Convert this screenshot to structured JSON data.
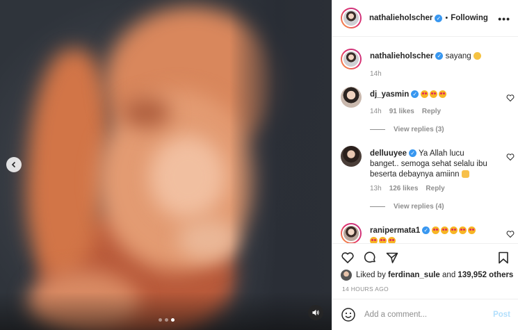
{
  "header": {
    "username": "nathalieholscher",
    "separator": "•",
    "follow_state": "Following",
    "more_label": "•••"
  },
  "caption": {
    "username": "nathalieholscher",
    "text": "sayang",
    "time": "14h"
  },
  "comments": [
    {
      "username": "dj_yasmin",
      "text": "",
      "emoji": [
        "smiling-face-with-heart-eyes",
        "smiling-face-with-heart-eyes",
        "smiling-face-with-heart-eyes"
      ],
      "time": "14h",
      "likes": "91 likes",
      "reply": "Reply",
      "view_replies": "View replies (3)"
    },
    {
      "username": "delluuyee",
      "text": "Ya Allah lucu banget.. semoga sehat selalu ibu beserta debaynya amiinn",
      "time": "13h",
      "likes": "126 likes",
      "reply": "Reply",
      "view_replies": "View replies (4)"
    },
    {
      "username": "ranipermata1",
      "text": ""
    }
  ],
  "liked_by": {
    "prefix": "Liked by",
    "user": "ferdinan_sule",
    "and": "and",
    "others": "139,952 others"
  },
  "timestamp": "14 HOURS AGO",
  "composer": {
    "placeholder": "Add a comment...",
    "post_label": "Post"
  },
  "carousel": {
    "total": 3,
    "active": 3
  },
  "colors": {
    "verified": "#3897f0",
    "post_disabled": "#b2dffc",
    "muted": "#8e8e8e"
  }
}
